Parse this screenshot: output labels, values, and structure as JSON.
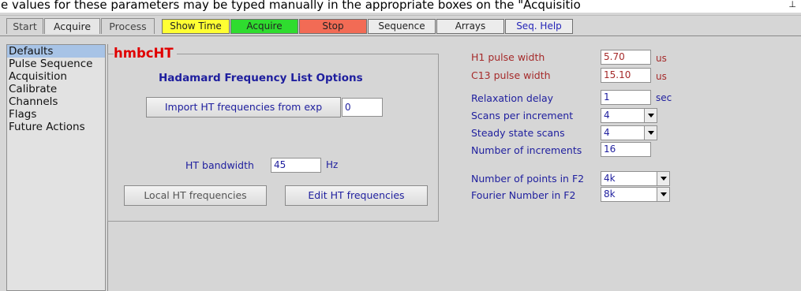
{
  "caption": "e values for these parameters may be typed manually in the appropriate boxes on the \"Acquisitio",
  "pin_icon": "pin-icon",
  "tabs": [
    "Start",
    "Acquire",
    "Process"
  ],
  "toolbar": {
    "show_time": "Show Time",
    "acquire": "Acquire",
    "stop": "Stop",
    "sequence": "Sequence",
    "arrays": "Arrays",
    "seq_help": "Seq. Help"
  },
  "sidebar": {
    "items": [
      "Defaults",
      "Pulse Sequence",
      "Acquisition",
      "Calibrate",
      "Channels",
      "Flags",
      "Future Actions"
    ]
  },
  "panel": {
    "title": "hmbcHT",
    "subtitle": "Hadamard Frequency List Options",
    "import_button": "Import HT frequencies from exp",
    "import_value": "0",
    "bandwidth_label": "HT bandwidth",
    "bandwidth_value": "45",
    "bandwidth_unit": "Hz",
    "local_button": "Local HT frequencies",
    "edit_button": "Edit HT frequencies"
  },
  "params": {
    "h1_label": "H1 pulse width",
    "h1_value": "5.70",
    "h1_unit": "us",
    "c13_label": "C13 pulse width",
    "c13_value": "15.10",
    "c13_unit": "us",
    "relax_label": "Relaxation delay",
    "relax_value": "1",
    "relax_unit": "sec",
    "scans_label": "Scans per increment",
    "scans_value": "4",
    "steady_label": "Steady state scans",
    "steady_value": "4",
    "incr_label": "Number of increments",
    "incr_value": "16",
    "points_label": "Number of points in F2",
    "points_value": "4k",
    "fourier_label": "Fourier Number in F2",
    "fourier_value": "8k"
  },
  "colors": {
    "title_red": "#e00000",
    "label_blue": "#1e1e9e",
    "label_brown": "#a52a2a",
    "show_time_bg": "#ffff33",
    "acquire_bg": "#2fdc2f",
    "stop_bg": "#f26b55",
    "selection_bg": "#a7c3e6"
  }
}
